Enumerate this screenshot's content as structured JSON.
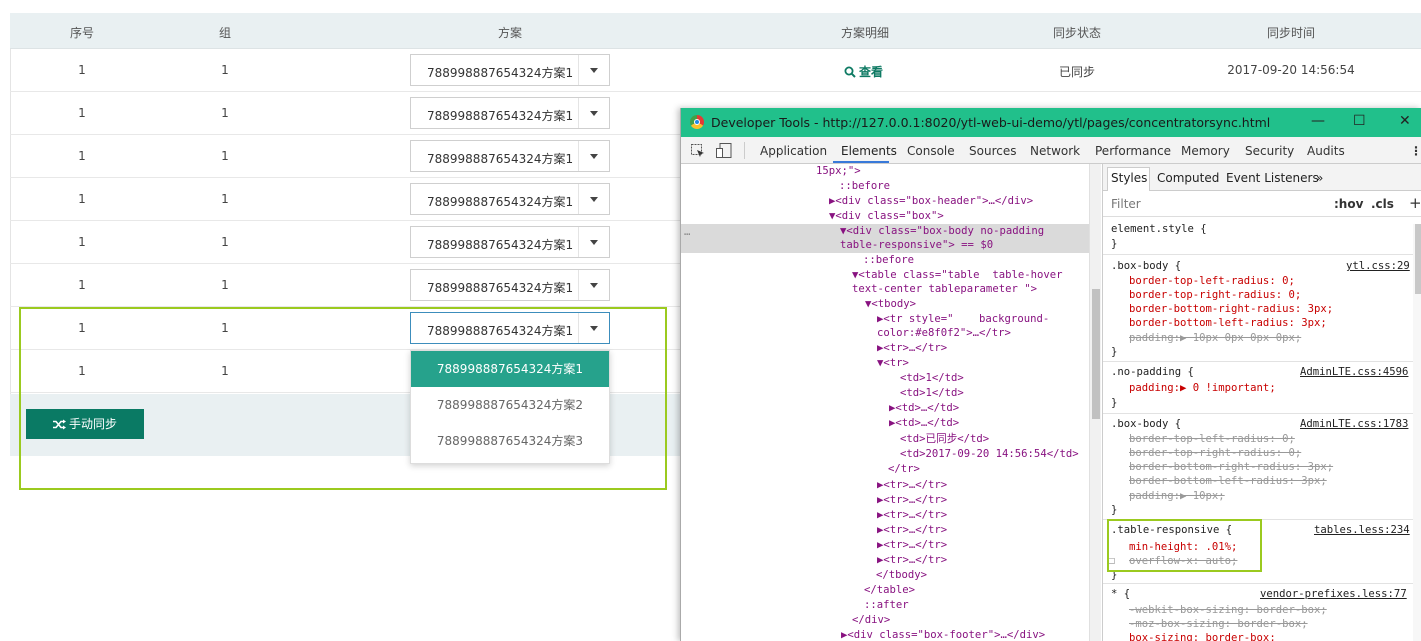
{
  "table": {
    "headers": [
      "序号",
      "组",
      "方案",
      "方案明细",
      "同步状态",
      "同步时间"
    ],
    "rows": [
      {
        "index": "1",
        "group": "1",
        "plan": "788998887654324方案1",
        "detail": "查看",
        "status": "已同步",
        "time": "2017-09-20 14:56:54"
      },
      {
        "index": "1",
        "group": "1",
        "plan": "788998887654324方案1"
      },
      {
        "index": "1",
        "group": "1",
        "plan": "788998887654324方案1"
      },
      {
        "index": "1",
        "group": "1",
        "plan": "788998887654324方案1"
      },
      {
        "index": "1",
        "group": "1",
        "plan": "788998887654324方案1"
      },
      {
        "index": "1",
        "group": "1",
        "plan": "788998887654324方案1"
      },
      {
        "index": "1",
        "group": "1",
        "plan": "788998887654324方案1"
      },
      {
        "index": "1",
        "group": "1"
      }
    ],
    "dropdown_options": [
      "788998887654324方案1",
      "788998887654324方案2",
      "788998887654324方案3"
    ],
    "sync_button": "手动同步"
  },
  "devtools": {
    "title": "Developer Tools - http://127.0.0.1:8020/ytl-web-ui-demo/ytl/pages/concentratorsync.html",
    "tabs": [
      "Application",
      "Elements",
      "Console",
      "Sources",
      "Network",
      "Performance",
      "Memory",
      "Security",
      "Audits"
    ],
    "side_tabs": [
      "Styles",
      "Computed",
      "Event Listeners",
      "»"
    ],
    "filter_placeholder": "Filter",
    "hov": ":hov",
    "cls": ".cls",
    "plus": "+",
    "dots": "⋮",
    "sel_marker": "…",
    "checkbox_icon": "☐",
    "titlebar_icons": {
      "minimize": "—",
      "maximize": "☐",
      "close": "✕"
    },
    "elements_lines": [
      "15px;\">",
      "::before",
      "▶<div class=\"box-header\">…</div>",
      "▼<div class=\"box\">",
      "▼<div class=\"box-body no-padding",
      "table-responsive\"> == $0",
      "::before",
      "▼<table class=\"table  table-hover",
      "text-center tableparameter \">",
      "▼<tbody>",
      "▶<tr style=\"    background-",
      "color:#e8f0f2\">…</tr>",
      "▶<tr>…</tr>",
      "▼<tr>",
      "<td>1</td>",
      "<td>1</td>",
      "▶<td>…</td>",
      "▶<td>…</td>",
      "<td>已同步</td>",
      "<td>2017-09-20 14:56:54</td>",
      "</tr>",
      "▶<tr>…</tr>",
      "▶<tr>…</tr>",
      "▶<tr>…</tr>",
      "▶<tr>…</tr>",
      "▶<tr>…</tr>",
      "▶<tr>…</tr>",
      "</tbody>",
      "</table>",
      "::after",
      "</div>",
      "▶<div class=\"box-footer\">…</div>"
    ],
    "styles_lines": [
      "element.style {",
      "}",
      ".box-body {",
      "border-top-left-radius: 0;",
      "border-top-right-radius: 0;",
      "border-bottom-right-radius: 3px;",
      "border-bottom-left-radius: 3px;",
      "padding:▶ 10px 0px 0px 0px;",
      "}",
      ".no-padding {",
      "padding:▶ 0 !important;",
      "}",
      ".box-body {",
      "border-top-left-radius: 0;",
      "border-top-right-radius: 0;",
      "border-bottom-right-radius: 3px;",
      "border-bottom-left-radius: 3px;",
      "padding:▶ 10px;",
      "}",
      ".table-responsive {",
      "min-height: .01%;",
      "overflow-x: auto;",
      "}",
      "* {",
      "-webkit-box-sizing: border-box;",
      "-moz-box-sizing: border-box;",
      "box-sizing: border-box;"
    ],
    "sources": [
      "ytl.css:29",
      "AdminLTE.css:4596",
      "AdminLTE.css:1783",
      "tables.less:234",
      "vendor-prefixes.less:77"
    ]
  },
  "colors": {
    "accent": "#0a7a64",
    "dropdown_active": "#26a28c",
    "highlight": "#9bca1f",
    "devtools_title": "#21c08b"
  }
}
